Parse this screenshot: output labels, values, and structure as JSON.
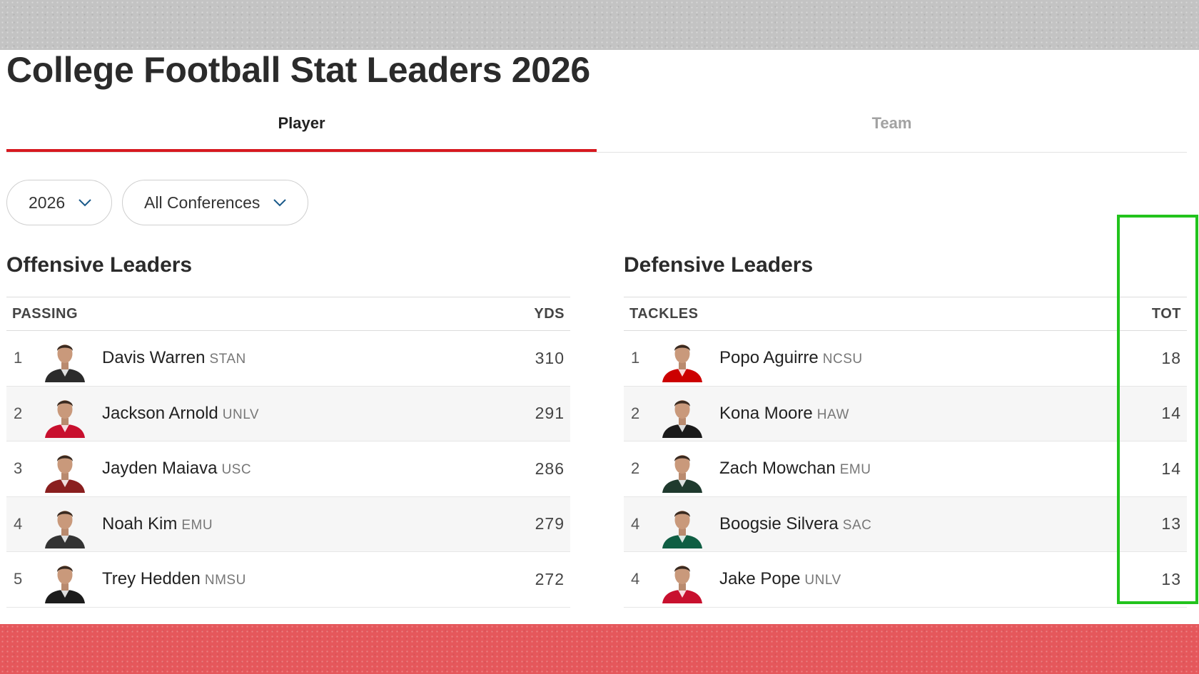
{
  "page": {
    "title": "College Football Stat Leaders 2026"
  },
  "tabs": [
    {
      "label": "Player",
      "active": true
    },
    {
      "label": "Team",
      "active": false
    }
  ],
  "filters": {
    "year": "2026",
    "conference": "All Conferences"
  },
  "colors": {
    "accent_red": "#d71920",
    "highlight_green": "#22c31d",
    "top_band": "#c3c3c3",
    "bottom_band": "#e5575b"
  },
  "offense": {
    "title": "Offensive Leaders",
    "category": "PASSING",
    "stat": "YDS",
    "rows": [
      {
        "rank": "1",
        "name": "Davis Warren",
        "team": "STAN",
        "value": "310",
        "jersey": "#2b2b2b"
      },
      {
        "rank": "2",
        "name": "Jackson Arnold",
        "team": "UNLV",
        "value": "291",
        "jersey": "#c8102e"
      },
      {
        "rank": "3",
        "name": "Jayden Maiava",
        "team": "USC",
        "value": "286",
        "jersey": "#8a1f1f"
      },
      {
        "rank": "4",
        "name": "Noah Kim",
        "team": "EMU",
        "value": "279",
        "jersey": "#333333"
      },
      {
        "rank": "5",
        "name": "Trey Hedden",
        "team": "NMSU",
        "value": "272",
        "jersey": "#1c1c1c"
      }
    ]
  },
  "defense": {
    "title": "Defensive Leaders",
    "category": "TACKLES",
    "stat": "TOT",
    "rows": [
      {
        "rank": "1",
        "name": "Popo Aguirre",
        "team": "NCSU",
        "value": "18",
        "jersey": "#cc0000"
      },
      {
        "rank": "2",
        "name": "Kona Moore",
        "team": "HAW",
        "value": "14",
        "jersey": "#1a1a1a"
      },
      {
        "rank": "2",
        "name": "Zach Mowchan",
        "team": "EMU",
        "value": "14",
        "jersey": "#1f3a2e"
      },
      {
        "rank": "4",
        "name": "Boogsie Silvera",
        "team": "SAC",
        "value": "13",
        "jersey": "#0f5e43"
      },
      {
        "rank": "4",
        "name": "Jake Pope",
        "team": "UNLV",
        "value": "13",
        "jersey": "#c8102e"
      }
    ]
  }
}
